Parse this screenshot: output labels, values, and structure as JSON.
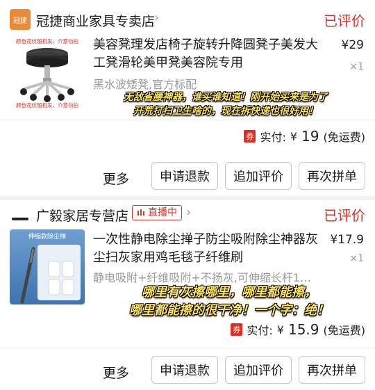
{
  "orders": [
    {
      "shop_name": "冠捷商业家具专卖店",
      "shop_logo_text": "冠捷",
      "status": "已评价",
      "product_title": "美容凳理发店椅子旋转升降圆凳子美发大工凳滑轮美甲凳美容院专用",
      "spec": "黑水波矮凳,官方标配",
      "price": "¥29",
      "qty": "×1",
      "thumb_caption_top": "颜色花纹随机发，介意勿拍",
      "thumb_caption_bottom": "颜色花纹随机发，介意勿拍",
      "comment_line1": "无敌省腰神器，谁买谁知道！刚开始买来是为了",
      "comment_line2": "开荒打扫卫生啥的，现在拆快递也很好用！",
      "coupon": "券",
      "total_label": "实付:",
      "total_currency": "¥",
      "total_amount": "19",
      "shipping": "(免运费)",
      "actions": [
        "更多",
        "申请退款",
        "追加评价",
        "再次拼单"
      ]
    },
    {
      "shop_name": "广毅家居专营店",
      "live_label": "直播中",
      "status": "已评价",
      "product_title": "一次性静电除尘掸子防尘吸附除尘神器灰尘扫灰家用鸡毛毯子纤维刷",
      "spec": "静电吸附+纤维吸附+不扬灰,可伸缩长杆1…",
      "price": "¥17.9",
      "qty": "×1",
      "thumb_caption": "伸缩款除尘掸",
      "comment_line1": "哪里有灰擦哪里，哪里都能擦，",
      "comment_line2": "哪里都能擦的很干净！一个字：绝！",
      "coupon": "券",
      "total_label": "实付:",
      "total_currency": "¥",
      "total_amount": "15.9",
      "shipping": "(免运费)",
      "actions": [
        "更多",
        "申请退款",
        "追加评价",
        "再次拼单"
      ]
    }
  ],
  "colors": {
    "accent": "#e02e24",
    "comment_text": "#ffe45e",
    "muted": "#999999"
  },
  "icons": [
    "shop-logo",
    "chevron-right-icon",
    "live-icon",
    "coupon-icon"
  ]
}
